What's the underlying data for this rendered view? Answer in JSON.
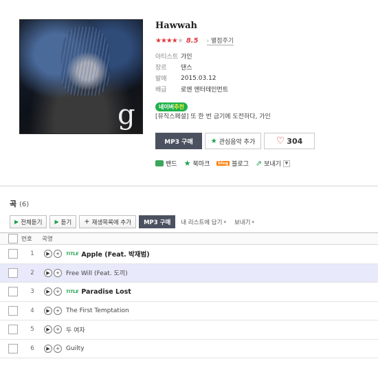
{
  "album": {
    "title": "Hawwah",
    "rating": "8.5",
    "rate_link": "별점주기",
    "info": [
      {
        "label": "아티스트",
        "value": "가인"
      },
      {
        "label": "장르",
        "value": "댄스"
      },
      {
        "label": "발매",
        "value": "2015.03.12"
      },
      {
        "label": "배급",
        "value": "로엔 엔터테인먼트"
      }
    ],
    "badge": {
      "prefix": "네이버",
      "highlight": "추천"
    },
    "catchphrase": "[뮤직스페셜] 또 한 번 금기에 도전하다, 가인",
    "buy_button": "MP3 구매",
    "fav_button": "관심음악 추가",
    "like_count": "304",
    "share": {
      "band": "밴드",
      "bookmark": "북마크",
      "blog": "블로그",
      "send": "보내기",
      "blog_icon": "blog"
    },
    "cover_logo": "g"
  },
  "tracks_section": {
    "title": "곡",
    "count": "(6)",
    "toolbar": {
      "play_all": "전체듣기",
      "play": "듣기",
      "add_playlist": "재생목록에 추가",
      "buy": "MP3 구매",
      "my_list": "내 리스트에 담기",
      "send": "보내기"
    },
    "headers": {
      "no": "번호",
      "title": "곡명"
    },
    "title_tag": "TITLE",
    "tracks": [
      {
        "no": "1",
        "title": "Apple (Feat. 박재범)",
        "is_title": true
      },
      {
        "no": "2",
        "title": "Free Will (Feat. 도끼)",
        "is_title": false
      },
      {
        "no": "3",
        "title": "Paradise Lost",
        "is_title": true
      },
      {
        "no": "4",
        "title": "The First Temptation",
        "is_title": false
      },
      {
        "no": "5",
        "title": "두 여자",
        "is_title": false
      },
      {
        "no": "6",
        "title": "Guilty",
        "is_title": false
      }
    ]
  },
  "colors": {
    "accent_green": "#1da04a",
    "star_red": "#e0393e",
    "button_dark": "#4c5160",
    "selected_row": "#e8e9fa"
  }
}
